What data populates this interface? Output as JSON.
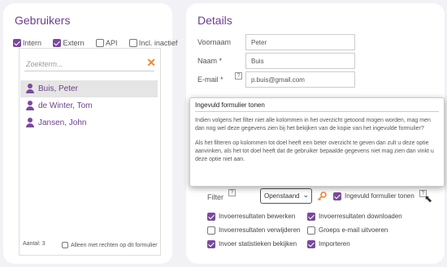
{
  "left": {
    "title": "Gebruikers",
    "filters": [
      {
        "label": "Intern",
        "checked": true
      },
      {
        "label": "Extern",
        "checked": true
      },
      {
        "label": "API",
        "checked": false
      },
      {
        "label": "Incl. inactief",
        "checked": false
      }
    ],
    "search_placeholder": "Zoekterm...",
    "users": [
      {
        "name": "Buis, Peter",
        "selected": true
      },
      {
        "name": "de Winter, Tom",
        "selected": false
      },
      {
        "name": "Jansen, John",
        "selected": false
      }
    ],
    "count": "Aantal: 3",
    "rechten_label": "Alleen met rechten op dit formulier"
  },
  "right": {
    "title": "Details",
    "fields": [
      {
        "label": "Voornaam",
        "value": "Peter"
      },
      {
        "label": "Naam *",
        "value": "Buis"
      },
      {
        "label": "E-mail *",
        "value": "p.buis@gmail.com"
      }
    ],
    "filter_label": "Filter",
    "filter_value": "Openstaand",
    "show_filled_label": "Ingevuld formulier tonen",
    "options": [
      {
        "label": "Invoerresultaten bewerken",
        "checked": true
      },
      {
        "label": "Invoerresultaten downloaden",
        "checked": true
      },
      {
        "label": "Invoerresultaten verwijderen",
        "checked": false
      },
      {
        "label": "Groeps e-mail uitvoeren",
        "checked": false
      },
      {
        "label": "Invoer statistieken bekijken",
        "checked": true
      },
      {
        "label": "Importeren",
        "checked": true
      }
    ]
  },
  "tooltip": {
    "title": "Ingevuld formulier tonen",
    "paragraph1": "Indien volgens het filter niet alle kolommen in het overzicht getoond mogen worden, mag men dan nog wel deze gegevens zien bij het bekijken van de kopie van het ingevulde formulier?",
    "paragraph2": "Als het filteren op kolommen tot doel heeft een beter overzicht te geven dan zult u deze optie aanvinken, als het tot doel heeft dat de gebruiker bepaalde gegevens niet mag zien dan vinkt u deze optie niet aan."
  },
  "colors": {
    "accent": "#6b3f8c",
    "orange": "#e8893a"
  }
}
